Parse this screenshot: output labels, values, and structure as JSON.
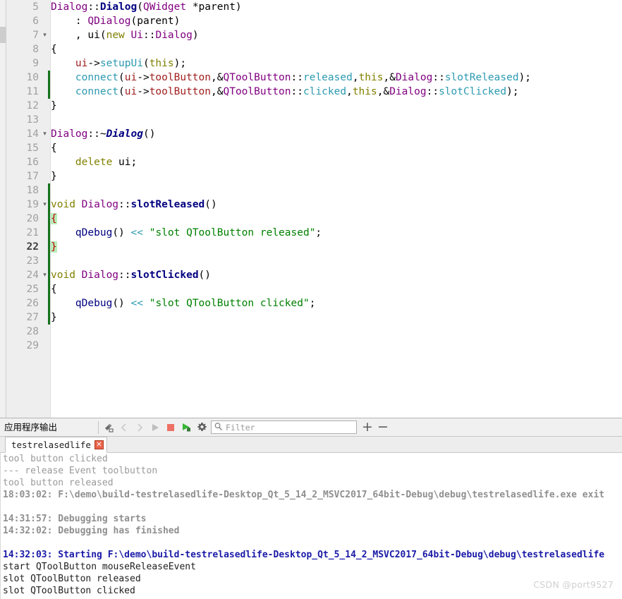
{
  "editor": {
    "first_visible_line": 5,
    "current_line": 22,
    "lines": [
      {
        "num": "5",
        "fold": "",
        "changed": false,
        "tokens": [
          {
            "t": "Dialog",
            "c": "t-class"
          },
          {
            "t": "::",
            "c": "t-op"
          },
          {
            "t": "Dialog",
            "c": "t-func"
          },
          {
            "t": "(",
            "c": "t-op"
          },
          {
            "t": "QWidget",
            "c": "t-class"
          },
          {
            "t": " *parent)",
            "c": "t-op"
          }
        ]
      },
      {
        "num": "6",
        "fold": "",
        "changed": false,
        "tokens": [
          {
            "t": "    : ",
            "c": "t-op"
          },
          {
            "t": "QDialog",
            "c": "t-class"
          },
          {
            "t": "(parent)",
            "c": "t-op"
          }
        ]
      },
      {
        "num": "7",
        "fold": "▾",
        "changed": false,
        "tokens": [
          {
            "t": "    , ",
            "c": "t-op"
          },
          {
            "t": "ui",
            "c": "t-op"
          },
          {
            "t": "(",
            "c": "t-op"
          },
          {
            "t": "new",
            "c": "t-kw"
          },
          {
            "t": " ",
            "c": "t-op"
          },
          {
            "t": "Ui",
            "c": "t-class"
          },
          {
            "t": "::",
            "c": "t-op"
          },
          {
            "t": "Dialog",
            "c": "t-class"
          },
          {
            "t": ")",
            "c": "t-op"
          }
        ]
      },
      {
        "num": "8",
        "fold": "",
        "changed": false,
        "tokens": [
          {
            "t": "{",
            "c": "t-op"
          }
        ]
      },
      {
        "num": "9",
        "fold": "",
        "changed": false,
        "tokens": [
          {
            "t": "    ",
            "c": "t-op"
          },
          {
            "t": "ui",
            "c": "t-member"
          },
          {
            "t": "->",
            "c": "t-op"
          },
          {
            "t": "setupUi",
            "c": "t-call"
          },
          {
            "t": "(",
            "c": "t-op"
          },
          {
            "t": "this",
            "c": "t-kw"
          },
          {
            "t": ");",
            "c": "t-op"
          }
        ]
      },
      {
        "num": "10",
        "fold": "",
        "changed": true,
        "tokens": [
          {
            "t": "    ",
            "c": "t-op"
          },
          {
            "t": "connect",
            "c": "t-call"
          },
          {
            "t": "(",
            "c": "t-op"
          },
          {
            "t": "ui",
            "c": "t-member"
          },
          {
            "t": "->",
            "c": "t-op"
          },
          {
            "t": "toolButton",
            "c": "t-member"
          },
          {
            "t": ",&",
            "c": "t-op"
          },
          {
            "t": "QToolButton",
            "c": "t-class"
          },
          {
            "t": "::",
            "c": "t-op"
          },
          {
            "t": "released",
            "c": "t-call"
          },
          {
            "t": ",",
            "c": "t-op"
          },
          {
            "t": "this",
            "c": "t-kw"
          },
          {
            "t": ",&",
            "c": "t-op"
          },
          {
            "t": "Dialog",
            "c": "t-class"
          },
          {
            "t": "::",
            "c": "t-op"
          },
          {
            "t": "slotReleased",
            "c": "t-call"
          },
          {
            "t": ");",
            "c": "t-op"
          }
        ]
      },
      {
        "num": "11",
        "fold": "",
        "changed": true,
        "tokens": [
          {
            "t": "    ",
            "c": "t-op"
          },
          {
            "t": "connect",
            "c": "t-call"
          },
          {
            "t": "(",
            "c": "t-op"
          },
          {
            "t": "ui",
            "c": "t-member"
          },
          {
            "t": "->",
            "c": "t-op"
          },
          {
            "t": "toolButton",
            "c": "t-member"
          },
          {
            "t": ",&",
            "c": "t-op"
          },
          {
            "t": "QToolButton",
            "c": "t-class"
          },
          {
            "t": "::",
            "c": "t-op"
          },
          {
            "t": "clicked",
            "c": "t-call"
          },
          {
            "t": ",",
            "c": "t-op"
          },
          {
            "t": "this",
            "c": "t-kw"
          },
          {
            "t": ",&",
            "c": "t-op"
          },
          {
            "t": "Dialog",
            "c": "t-class"
          },
          {
            "t": "::",
            "c": "t-op"
          },
          {
            "t": "slotClicked",
            "c": "t-call"
          },
          {
            "t": ");",
            "c": "t-op"
          }
        ]
      },
      {
        "num": "12",
        "fold": "",
        "changed": false,
        "tokens": [
          {
            "t": "}",
            "c": "t-op"
          }
        ]
      },
      {
        "num": "13",
        "fold": "",
        "changed": false,
        "tokens": []
      },
      {
        "num": "14",
        "fold": "▾",
        "changed": false,
        "tokens": [
          {
            "t": "Dialog",
            "c": "t-class"
          },
          {
            "t": "::~",
            "c": "t-op"
          },
          {
            "t": "Dialog",
            "c": "t-funcit"
          },
          {
            "t": "()",
            "c": "t-op"
          }
        ]
      },
      {
        "num": "15",
        "fold": "",
        "changed": false,
        "tokens": [
          {
            "t": "{",
            "c": "t-op"
          }
        ]
      },
      {
        "num": "16",
        "fold": "",
        "changed": false,
        "tokens": [
          {
            "t": "    ",
            "c": "t-op"
          },
          {
            "t": "delete",
            "c": "t-kw"
          },
          {
            "t": " ui;",
            "c": "t-op"
          }
        ]
      },
      {
        "num": "17",
        "fold": "",
        "changed": false,
        "tokens": [
          {
            "t": "}",
            "c": "t-op"
          }
        ]
      },
      {
        "num": "18",
        "fold": "",
        "changed": true,
        "tokens": []
      },
      {
        "num": "19",
        "fold": "▾",
        "changed": true,
        "tokens": [
          {
            "t": "void",
            "c": "t-kw"
          },
          {
            "t": " ",
            "c": "t-op"
          },
          {
            "t": "Dialog",
            "c": "t-class"
          },
          {
            "t": "::",
            "c": "t-op"
          },
          {
            "t": "slotReleased",
            "c": "t-func"
          },
          {
            "t": "()",
            "c": "t-op"
          }
        ]
      },
      {
        "num": "20",
        "fold": "",
        "changed": true,
        "tokens": [
          {
            "t": "{",
            "c": "brace-hl"
          }
        ]
      },
      {
        "num": "21",
        "fold": "",
        "changed": true,
        "tokens": [
          {
            "t": "    ",
            "c": "t-op"
          },
          {
            "t": "qDebug",
            "c": "t-qdebug"
          },
          {
            "t": "()",
            "c": "t-op"
          },
          {
            "t": " ",
            "c": "t-op"
          },
          {
            "t": "<<",
            "c": "t-shift"
          },
          {
            "t": " ",
            "c": "t-op"
          },
          {
            "t": "\"slot QToolButton released\"",
            "c": "t-str"
          },
          {
            "t": ";",
            "c": "t-op"
          }
        ]
      },
      {
        "num": "22",
        "fold": "",
        "changed": true,
        "current": true,
        "tokens": [
          {
            "t": "}",
            "c": "brace-hl"
          }
        ]
      },
      {
        "num": "23",
        "fold": "",
        "changed": true,
        "tokens": []
      },
      {
        "num": "24",
        "fold": "▾",
        "changed": true,
        "tokens": [
          {
            "t": "void",
            "c": "t-kw"
          },
          {
            "t": " ",
            "c": "t-op"
          },
          {
            "t": "Dialog",
            "c": "t-class"
          },
          {
            "t": "::",
            "c": "t-op"
          },
          {
            "t": "slotClicked",
            "c": "t-func"
          },
          {
            "t": "()",
            "c": "t-op"
          }
        ]
      },
      {
        "num": "25",
        "fold": "",
        "changed": true,
        "tokens": [
          {
            "t": "{",
            "c": "t-op"
          }
        ]
      },
      {
        "num": "26",
        "fold": "",
        "changed": true,
        "tokens": [
          {
            "t": "    ",
            "c": "t-op"
          },
          {
            "t": "qDebug",
            "c": "t-qdebug"
          },
          {
            "t": "()",
            "c": "t-op"
          },
          {
            "t": " ",
            "c": "t-op"
          },
          {
            "t": "<<",
            "c": "t-shift"
          },
          {
            "t": " ",
            "c": "t-op"
          },
          {
            "t": "\"slot QToolButton clicked\"",
            "c": "t-str"
          },
          {
            "t": ";",
            "c": "t-op"
          }
        ]
      },
      {
        "num": "27",
        "fold": "",
        "changed": true,
        "tokens": [
          {
            "t": "}",
            "c": "t-op"
          }
        ]
      },
      {
        "num": "28",
        "fold": "",
        "changed": false,
        "tokens": []
      },
      {
        "num": "29",
        "fold": "",
        "changed": false,
        "tokens": []
      }
    ]
  },
  "output_pane": {
    "title": "应用程序输出",
    "toolbar": {
      "clear_icon": "clear-pane-icon",
      "prev_icon": "previous-item-icon",
      "next_icon": "next-item-icon",
      "run_icon": "run-icon",
      "stop_icon": "stop-icon",
      "rerun_icon": "re-run-icon",
      "settings_icon": "gear-icon",
      "search_icon": "search-icon",
      "zoom_in_label": "+",
      "zoom_out_label": "−"
    },
    "filter": {
      "value": "",
      "placeholder": "Filter"
    },
    "tab": {
      "label": "testrelasedlife",
      "close_label": "✕"
    },
    "console_lines": [
      {
        "text": "tool button clicked",
        "style": "c-gray"
      },
      {
        "text": "--- release Event toolbutton",
        "style": "c-gray"
      },
      {
        "text": "tool button released",
        "style": "c-gray"
      },
      {
        "text": "18:03:02: F:\\demo\\build-testrelasedlife-Desktop_Qt_5_14_2_MSVC2017_64bit-Debug\\debug\\testrelasedlife.exe exit",
        "style": "c-grayb"
      },
      {
        "text": "",
        "style": "c-gray"
      },
      {
        "text": "14:31:57: Debugging starts",
        "style": "c-grayb"
      },
      {
        "text": "14:32:02: Debugging has finished",
        "style": "c-grayb"
      },
      {
        "text": "",
        "style": "c-gray"
      },
      {
        "text": "14:32:03: Starting F:\\demo\\build-testrelasedlife-Desktop_Qt_5_14_2_MSVC2017_64bit-Debug\\debug\\testrelasedlife",
        "style": "c-blueb"
      },
      {
        "text": "start QToolButton mouseReleaseEvent",
        "style": "c-black"
      },
      {
        "text": "slot QToolButton released",
        "style": "c-black"
      },
      {
        "text": "slot QToolButton clicked",
        "style": "c-black"
      }
    ]
  },
  "watermark": {
    "text": "CSDN @port9527"
  },
  "colors": {
    "gutter_bg": "#eeeeee",
    "change_bar": "#17721c",
    "brace_highlight_bg": "#b9edb9",
    "brace_highlight_fg": "#c00000",
    "string": "#008000",
    "class": "#800080",
    "keyword": "#808000",
    "function_call": "#2c9ab0",
    "member": "#a02020",
    "console_start_line": "#1a1aa8",
    "tab_close": "#e8644a",
    "stop_button": "#e86a6a",
    "run_button": "#3fbf3f"
  }
}
